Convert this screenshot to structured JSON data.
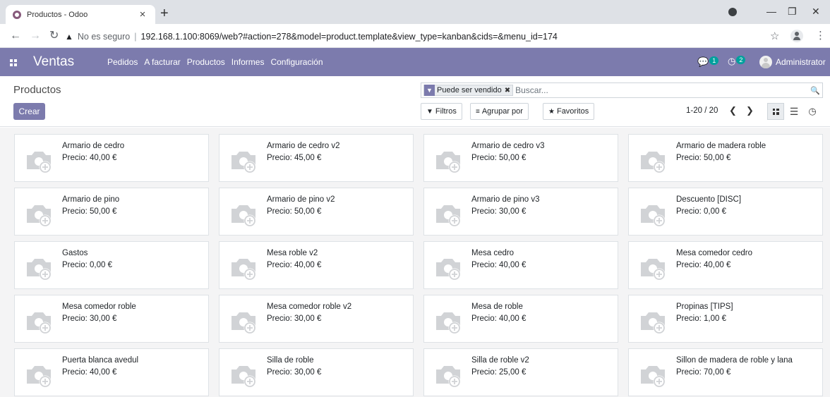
{
  "browser": {
    "tab_title": "Productos - Odoo",
    "tab_close": "×",
    "new_tab": "+",
    "insecure_label": "No es seguro",
    "separator": "|",
    "url": "192.168.1.100:8069/web?#action=278&model=product.template&view_type=kanban&cids=&menu_id=174"
  },
  "navbar": {
    "app_name": "Ventas",
    "menu": [
      "Pedidos",
      "A facturar",
      "Productos",
      "Informes",
      "Configuración"
    ],
    "messages_count": "1",
    "activities_count": "2",
    "user_name": "Administrator",
    "accent_color": "#7c7bad"
  },
  "control_panel": {
    "breadcrumb": "Productos",
    "create_label": "Crear",
    "facet_label": "Puede ser vendido",
    "search_placeholder": "Buscar...",
    "filters_label": "Filtros",
    "groupby_label": "Agrupar por",
    "favorites_label": "Favoritos",
    "pager": "1-20 / 20"
  },
  "products": [
    {
      "name": "Armario de cedro",
      "price": "Precio: 40,00 €"
    },
    {
      "name": "Armario de cedro v2",
      "price": "Precio: 45,00 €"
    },
    {
      "name": "Armario de cedro v3",
      "price": "Precio: 50,00 €"
    },
    {
      "name": "Armario de madera roble",
      "price": "Precio: 50,00 €"
    },
    {
      "name": "Armario de pino",
      "price": "Precio: 50,00 €"
    },
    {
      "name": "Armario de pino v2",
      "price": "Precio: 50,00 €"
    },
    {
      "name": "Armario de pino v3",
      "price": "Precio: 30,00 €"
    },
    {
      "name": "Descuento [DISC]",
      "price": "Precio: 0,00 €"
    },
    {
      "name": "Gastos",
      "price": "Precio: 0,00 €"
    },
    {
      "name": "Mesa roble v2",
      "price": "Precio: 40,00 €"
    },
    {
      "name": "Mesa cedro",
      "price": "Precio: 40,00 €"
    },
    {
      "name": "Mesa comedor cedro",
      "price": "Precio: 40,00 €"
    },
    {
      "name": "Mesa comedor roble",
      "price": "Precio: 30,00 €"
    },
    {
      "name": "Mesa comedor roble v2",
      "price": "Precio: 30,00 €"
    },
    {
      "name": "Mesa de roble",
      "price": "Precio: 40,00 €"
    },
    {
      "name": "Propinas [TIPS]",
      "price": "Precio: 1,00 €"
    },
    {
      "name": "Puerta blanca avedul",
      "price": "Precio: 40,00 €"
    },
    {
      "name": "Silla de roble",
      "price": "Precio: 30,00 €"
    },
    {
      "name": "Silla de roble v2",
      "price": "Precio: 25,00 €"
    },
    {
      "name": "Sillon de madera de roble y lana",
      "price": "Precio: 70,00 €"
    }
  ]
}
